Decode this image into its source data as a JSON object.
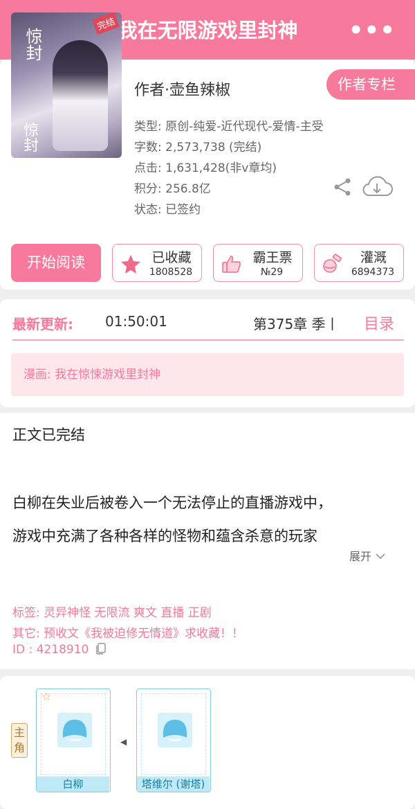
{
  "header": {
    "title": "我在无限游戏里封神",
    "more": "•••"
  },
  "book": {
    "cover_title": "惊封",
    "cover_badge": "完结",
    "author": "作者·壶鱼辣椒",
    "author_column": "作者专栏",
    "type": "类型: 原创-纯爱-近代现代-爱情-主受",
    "words": "字数: 2,573,738 (完结)",
    "clicks": "点击: 1,631,428(非v章均)",
    "points": "积分: 256.8亿",
    "status": "状态: 已签约"
  },
  "actions": {
    "start": "开始阅读",
    "collect": {
      "label": "已收藏",
      "count": "1808528"
    },
    "bawang": {
      "label": "霸王票",
      "count": "№29"
    },
    "guangai": {
      "label": "灌溉",
      "count": "6894373"
    }
  },
  "update": {
    "label": "最新更新:",
    "time": "01:50:01",
    "chapter": "第375章 季丨",
    "toc": "目录"
  },
  "comic": "漫画: 我在惊悚游戏里封神",
  "intro": {
    "status": "正文已完结",
    "line1": "白柳在失业后被卷入一个无法停止的直播游戏中，",
    "line2": "游戏中充满了各种各样的怪物和蕴含杀意的玩家",
    "expand": "展开"
  },
  "tags": "标签: 灵异神怪 无限流 爽文 直播 正剧",
  "other": "其它: 预收文《我被迫修无情道》求收藏！！",
  "id": "ID   : 4218910",
  "characters": {
    "role": "主角",
    "items": [
      {
        "name": "白柳"
      },
      {
        "name": "塔维尔 (谢塔)"
      }
    ]
  },
  "colors": {
    "accent": "#f7799b",
    "char_border": "#7dcde3"
  }
}
